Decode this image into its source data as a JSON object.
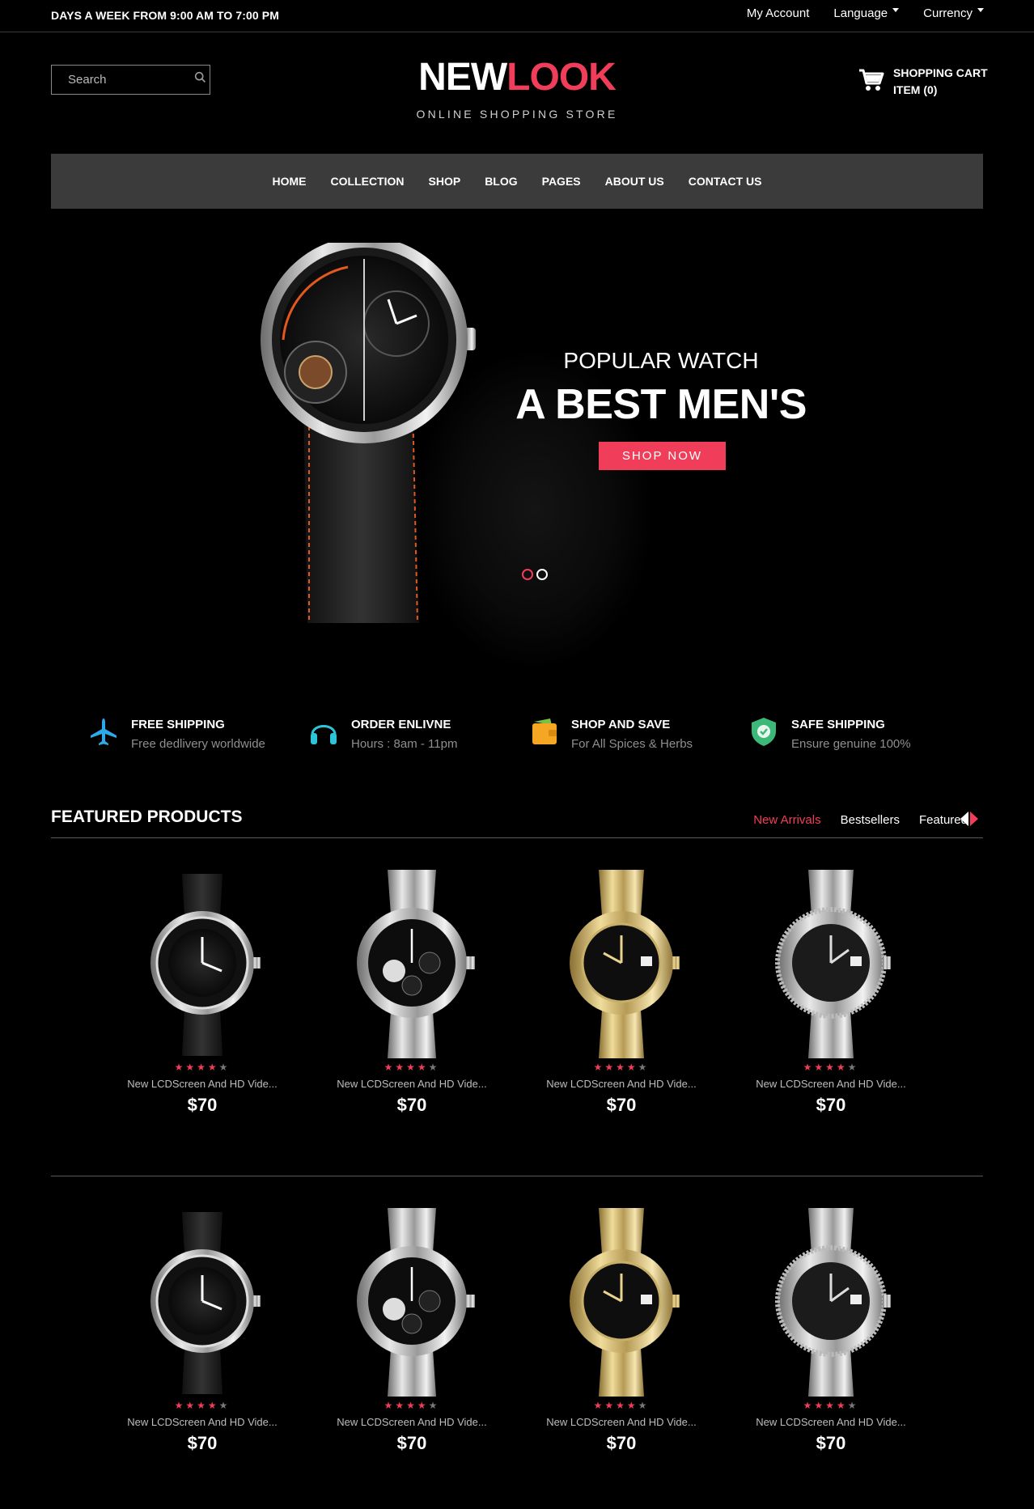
{
  "topbar": {
    "hours": "DAYS A WEEK FROM 9:00 AM TO 7:00 PM",
    "my_account": "My Account",
    "language": "Language",
    "currency": "Currency"
  },
  "header": {
    "search_placeholder": "Search",
    "logo_part1": "NEW",
    "logo_part2": "LOOK",
    "tagline": "ONLINE SHOPPING STORE",
    "cart_line1": "SHOPPING CART",
    "cart_line2": "ITEM (0)"
  },
  "nav": [
    "HOME",
    "COLLECTION",
    "SHOP",
    "BLOG",
    "PAGES",
    "ABOUT US",
    "CONTACT US"
  ],
  "hero": {
    "subtitle": "POPULAR WATCH",
    "title": "A BEST MEN'S",
    "button": "SHOP NOW",
    "slides": 2,
    "active_slide": 1
  },
  "features": [
    {
      "icon": "airplane-icon",
      "title": "FREE SHIPPING",
      "subtitle": "Free dedlivery worldwide"
    },
    {
      "icon": "headphones-icon",
      "title": "ORDER ENLIVNE",
      "subtitle": "Hours : 8am - 11pm"
    },
    {
      "icon": "wallet-icon",
      "title": "SHOP AND SAVE",
      "subtitle": "For All Spices & Herbs"
    },
    {
      "icon": "shield-check-icon",
      "title": "SAFE SHIPPING",
      "subtitle": "Ensure genuine 100%"
    }
  ],
  "featured": {
    "title": "FEATURED PRODUCTS",
    "tabs": [
      "New Arrivals",
      "Bestsellers",
      "Featured"
    ],
    "active_tab": "New Arrivals"
  },
  "products": [
    {
      "name": "New LCDScreen And HD Vide...",
      "price": "$70",
      "rating": 4,
      "max_rating": 5,
      "image": "black-diver-watch"
    },
    {
      "name": "New LCDScreen And HD Vide...",
      "price": "$70",
      "rating": 4,
      "max_rating": 5,
      "image": "silver-chronograph-watch"
    },
    {
      "name": "New LCDScreen And HD Vide...",
      "price": "$70",
      "rating": 4,
      "max_rating": 5,
      "image": "gold-watch"
    },
    {
      "name": "New LCDScreen And HD Vide...",
      "price": "$70",
      "rating": 4,
      "max_rating": 5,
      "image": "silver-datejust-watch"
    },
    {
      "name": "New LCDScreen And HD Vide...",
      "price": "$70",
      "rating": 4,
      "max_rating": 5,
      "image": "black-diver-watch"
    },
    {
      "name": "New LCDScreen And HD Vide...",
      "price": "$70",
      "rating": 4,
      "max_rating": 5,
      "image": "silver-chronograph-watch"
    },
    {
      "name": "New LCDScreen And HD Vide...",
      "price": "$70",
      "rating": 4,
      "max_rating": 5,
      "image": "gold-watch"
    },
    {
      "name": "New LCDScreen And HD Vide...",
      "price": "$70",
      "rating": 4,
      "max_rating": 5,
      "image": "silver-datejust-watch"
    }
  ],
  "colors": {
    "accent": "#f03e5a",
    "background": "#000000",
    "nav_bg": "#3b3b3b"
  }
}
